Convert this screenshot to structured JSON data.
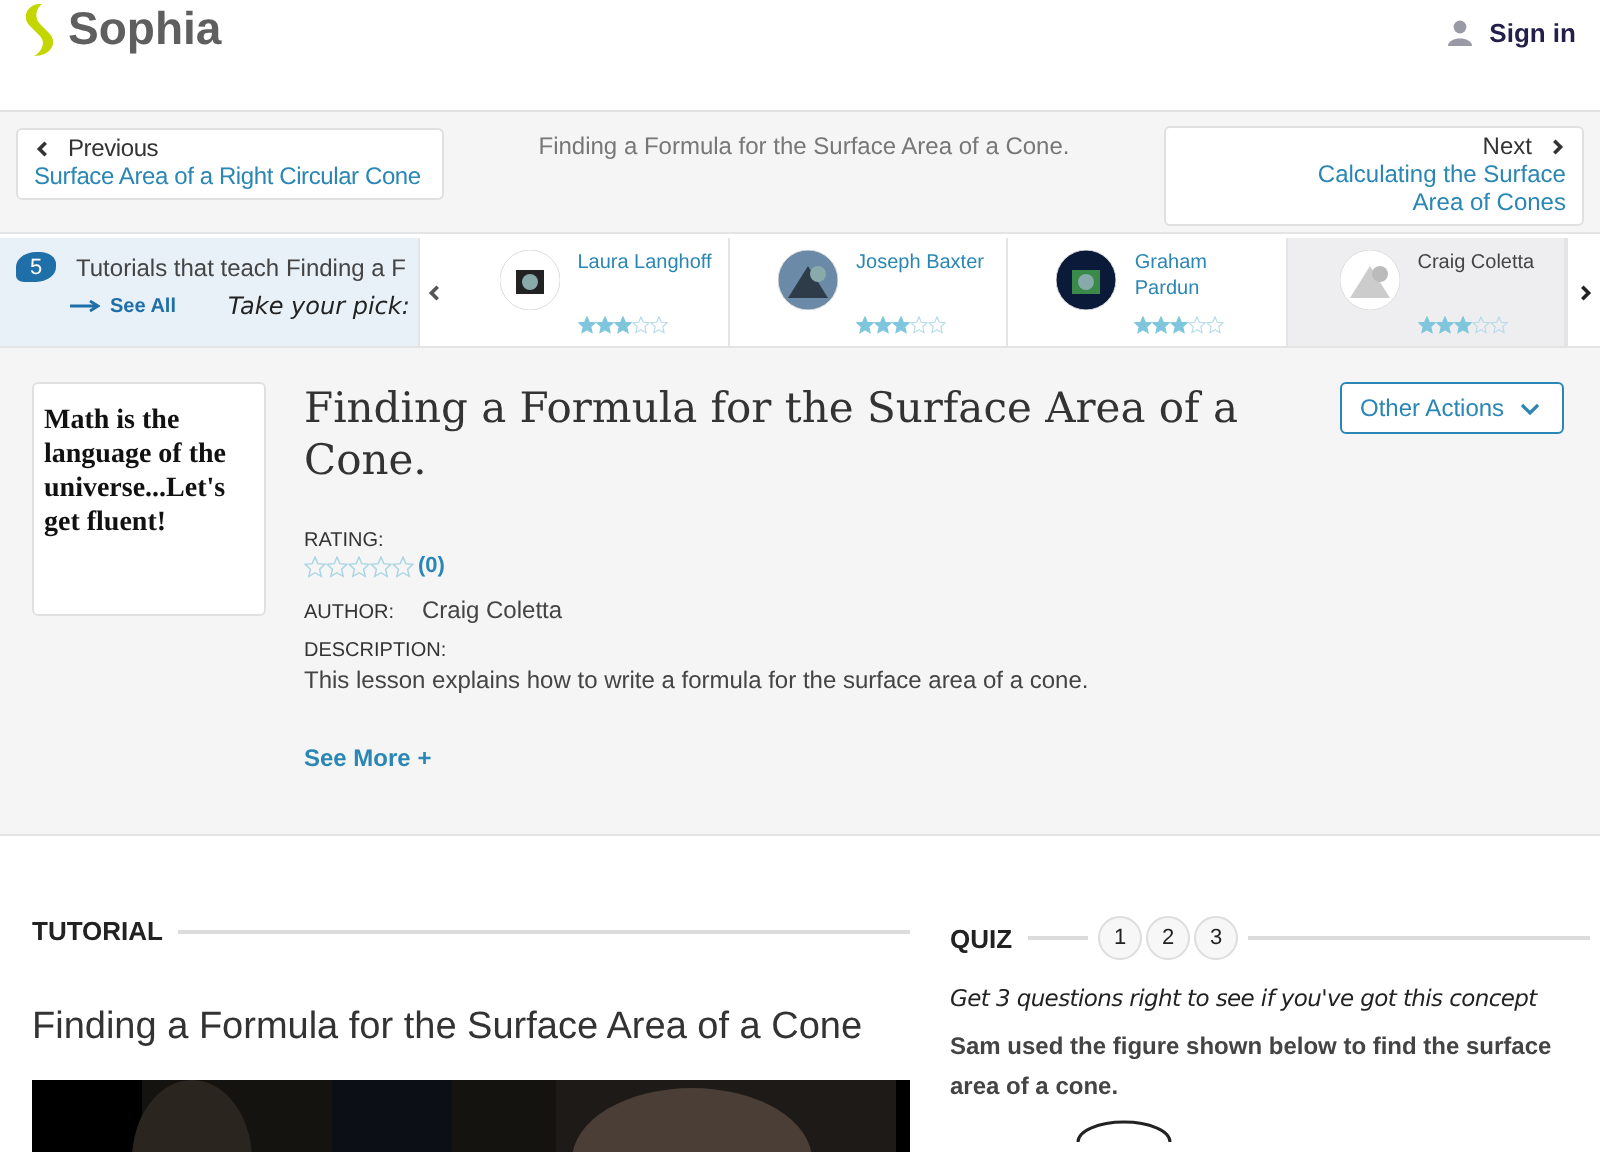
{
  "header": {
    "logo": "Sophia",
    "sign_in": "Sign in"
  },
  "navigation": {
    "previous": {
      "label": "Previous",
      "title": "Surface Area of a Right Circular Cone"
    },
    "current": "Finding a Formula for the Surface Area of a Cone.",
    "next": {
      "label": "Next",
      "title": "Calculating the Surface Area of Cones"
    }
  },
  "carousel": {
    "count": "5",
    "heading": "Tutorials that teach Finding a F",
    "see_all": "See All",
    "tagline": "Take your pick:",
    "tutors": [
      {
        "name": "Laura Langhoff",
        "stars": 3,
        "selected": false
      },
      {
        "name": "Joseph Baxter",
        "stars": 3,
        "selected": false
      },
      {
        "name": "Graham Pardun",
        "stars": 3,
        "selected": false
      },
      {
        "name": "Craig Coletta",
        "stars": 3,
        "selected": true
      }
    ]
  },
  "lesson": {
    "thumbnail_text": "Math is the language of the universe...Let's get fluent!",
    "title": "Finding a Formula for the Surface Area of a Cone.",
    "actions_button": "Other Actions",
    "rating_label": "RATING:",
    "stars": 0,
    "rating_count": "(0)",
    "author_label": "AUTHOR:",
    "author": "Craig Coletta",
    "description_label": "DESCRIPTION:",
    "description": "This lesson explains how to write a formula for the surface area of a cone.",
    "see_more": "See More +"
  },
  "tutorial": {
    "section": "TUTORIAL",
    "title": "Finding a Formula for the Surface Area of a Cone"
  },
  "quiz": {
    "section": "QUIZ",
    "steps": [
      "1",
      "2",
      "3"
    ],
    "tagline": "Get 3 questions right to see if you've got this concept",
    "question": "Sam used the figure shown below to find the surface area of a cone."
  }
}
